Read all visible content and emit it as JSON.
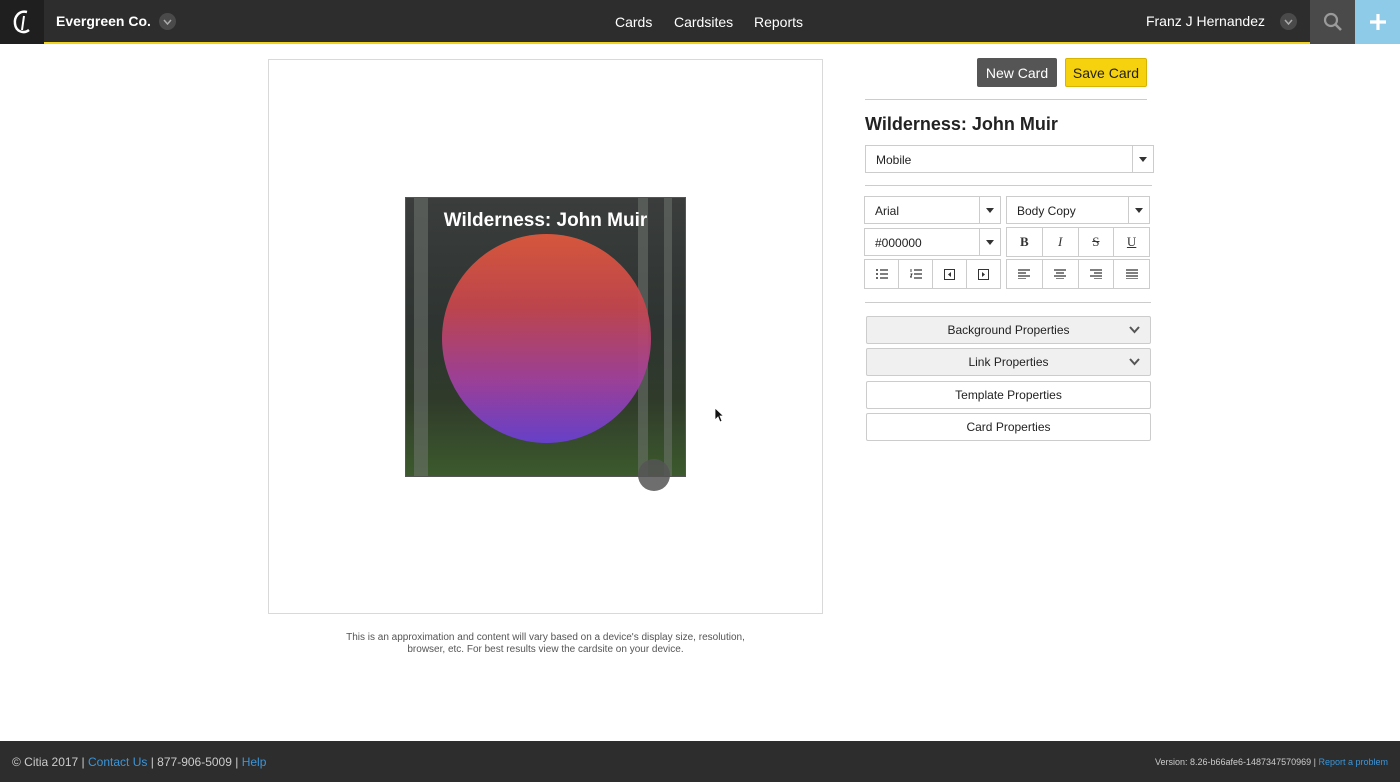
{
  "header": {
    "org_name": "Evergreen Co.",
    "nav": [
      "Cards",
      "Cardsites",
      "Reports"
    ],
    "user_name": "Franz J Hernandez",
    "accent_color": "#f2d21b"
  },
  "preview": {
    "card_title": "Wilderness: John Muir",
    "disclaimer_line1": "This is an approximation and content will vary based on a device's display size, resolution,",
    "disclaimer_line2": "browser, etc. For best results view the cardsite on your device."
  },
  "actions": {
    "new_card": "New Card",
    "save_card": "Save Card"
  },
  "panel": {
    "title": "Wilderness: John Muir",
    "device": "Mobile",
    "font": "Arial",
    "style": "Body Copy",
    "color": "#000000",
    "format_buttons": [
      "B",
      "I",
      "S",
      "U"
    ],
    "accordions": [
      "Background Properties",
      "Link Properties",
      "Template Properties",
      "Card Properties"
    ]
  },
  "footer": {
    "copyright": "© Citia 2017",
    "contact": "Contact Us",
    "phone": "877-906-5009",
    "help": "Help",
    "version": "Version: 8.26-b66afe6-1487347570969",
    "report": "Report a problem"
  }
}
